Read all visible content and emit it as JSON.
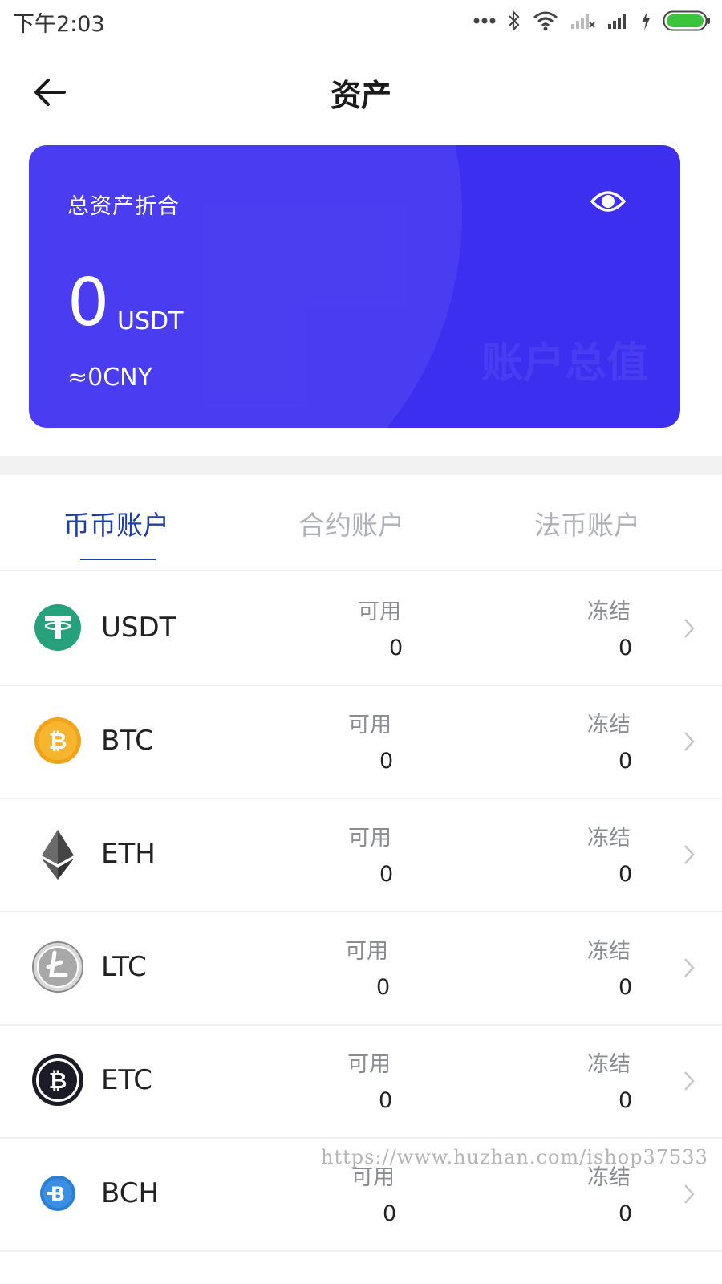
{
  "status_bar": {
    "time": "下午2:03"
  },
  "header": {
    "title": "资产"
  },
  "asset_card": {
    "label": "总资产折合",
    "amount": "0",
    "unit": "USDT",
    "cny": "≈0CNY",
    "watermark": "账户总值",
    "accent_color": "#3d2ff0"
  },
  "tabs": [
    {
      "label": "币币账户",
      "active": true
    },
    {
      "label": "合约账户",
      "active": false
    },
    {
      "label": "法币账户",
      "active": false
    }
  ],
  "columns": {
    "available": "可用",
    "frozen": "冻结"
  },
  "assets": [
    {
      "name": "USDT",
      "icon": "tether-icon",
      "available": "0",
      "frozen": "0"
    },
    {
      "name": "BTC",
      "icon": "bitcoin-icon",
      "available": "0",
      "frozen": "0"
    },
    {
      "name": "ETH",
      "icon": "ethereum-icon",
      "available": "0",
      "frozen": "0"
    },
    {
      "name": "LTC",
      "icon": "litecoin-icon",
      "available": "0",
      "frozen": "0"
    },
    {
      "name": "ETC",
      "icon": "ethereum-classic-icon",
      "available": "0",
      "frozen": "0"
    },
    {
      "name": "BCH",
      "icon": "bitcoin-cash-icon",
      "available": "0",
      "frozen": "0"
    }
  ],
  "watermark": "https://www.huzhan.com/ishop37533"
}
